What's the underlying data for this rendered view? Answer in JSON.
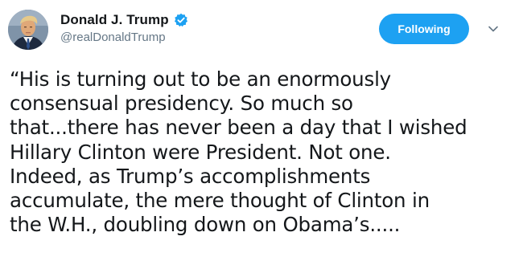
{
  "tweet": {
    "author": {
      "display_name": "Donald J. Trump",
      "handle": "@realDonaldTrump",
      "verified": true,
      "avatar_icon": "profile-photo"
    },
    "follow_button": {
      "label": "Following",
      "color": "#1da1f2"
    },
    "menu_icon": "chevron-down-icon",
    "text_lines": [
      "“His is turning out to be an enormously",
      "consensual presidency. So much so",
      "that...there has never been a day that I wished",
      "Hillary Clinton were President. Not one.",
      "Indeed, as Trump’s accomplishments",
      "accumulate, the mere thought of Clinton in",
      "the W.H., doubling down on Obama’s....."
    ]
  },
  "colors": {
    "text_primary": "#14171a",
    "text_secondary": "#657786",
    "accent": "#1da1f2"
  }
}
